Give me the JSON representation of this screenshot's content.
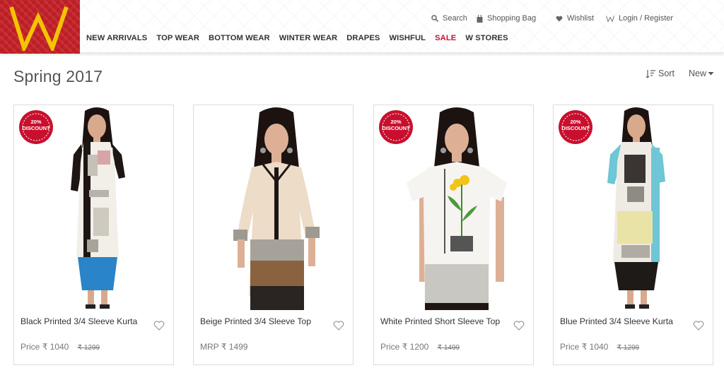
{
  "brand": {
    "name": "W",
    "accent": "#c42127",
    "logo_letter_color": "#f4c400"
  },
  "top_links": {
    "search": "Search",
    "bag": "Shopping Bag",
    "wishlist": "Wishlist",
    "login": "Login / Register"
  },
  "nav": [
    {
      "label": "NEW ARRIVALS"
    },
    {
      "label": "TOP WEAR"
    },
    {
      "label": "BOTTOM WEAR"
    },
    {
      "label": "WINTER WEAR"
    },
    {
      "label": "DRAPES"
    },
    {
      "label": "WISHFUL"
    },
    {
      "label": "SALE",
      "color": "#c8102e"
    },
    {
      "label": "W STORES"
    }
  ],
  "page": {
    "title": "Spring 2017",
    "sort_label": "Sort",
    "order_label": "New"
  },
  "badge_text": {
    "line1": "20%",
    "line2": "DISCOUNT"
  },
  "products": [
    {
      "name": "Black Printed 3/4 Sleeve Kurta",
      "price_prefix": "Price",
      "price": "₹ 1040",
      "old_price": "₹ 1299",
      "discount": true,
      "icon": "kurta-black-photo"
    },
    {
      "name": "Beige Printed 3/4 Sleeve Top",
      "price_prefix": "MRP",
      "price": "₹ 1499",
      "old_price": "",
      "discount": false,
      "icon": "top-beige-photo"
    },
    {
      "name": "White Printed Short Sleeve Top",
      "price_prefix": "Price",
      "price": "₹ 1200",
      "old_price": "₹ 1499",
      "discount": true,
      "icon": "top-white-photo"
    },
    {
      "name": "Blue Printed 3/4 Sleeve Kurta",
      "price_prefix": "Price",
      "price": "₹ 1040",
      "old_price": "₹ 1299",
      "discount": true,
      "icon": "kurta-blue-photo"
    }
  ]
}
